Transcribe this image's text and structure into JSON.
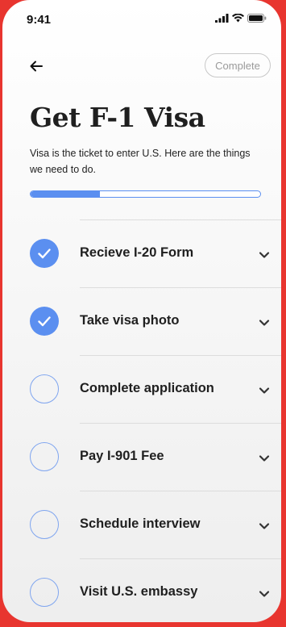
{
  "status_bar": {
    "time": "9:41",
    "icons": [
      "signal-icon",
      "wifi-icon",
      "battery-icon"
    ]
  },
  "header": {
    "back_icon": "back-arrow-icon",
    "complete_label": "Complete"
  },
  "title": "Get F-1 Visa",
  "subtitle": "Visa is the ticket to enter U.S. Here are the things we need to do.",
  "progress": {
    "fraction": 0.3
  },
  "tasks": [
    {
      "label": "Recieve I-20 Form",
      "done": true
    },
    {
      "label": "Take visa photo",
      "done": true
    },
    {
      "label": "Complete application",
      "done": false
    },
    {
      "label": "Pay I-901 Fee",
      "done": false
    },
    {
      "label": "Schedule interview",
      "done": false
    },
    {
      "label": "Visit U.S. embassy",
      "done": false
    }
  ],
  "colors": {
    "accent": "#5b8ff0",
    "background_frame": "#e8352f",
    "text": "#1f1f1f"
  }
}
